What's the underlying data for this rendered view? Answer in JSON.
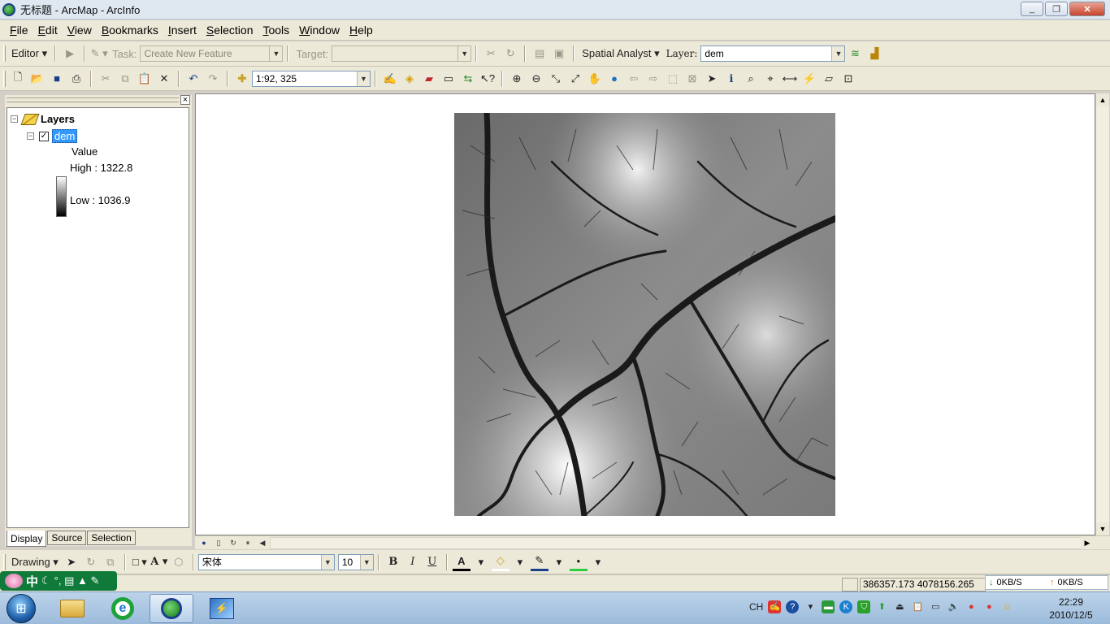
{
  "window": {
    "title": "无标题 - ArcMap - ArcInfo",
    "buttons": [
      "_",
      "❐",
      "✕"
    ]
  },
  "menu": [
    "File",
    "Edit",
    "View",
    "Bookmarks",
    "Insert",
    "Selection",
    "Tools",
    "Window",
    "Help"
  ],
  "editor_toolbar": {
    "editor_label": "Editor",
    "task_label": "Task:",
    "task_value": "Create New Feature",
    "target_label": "Target:",
    "target_value": "",
    "spatial_analyst_label": "Spatial Analyst",
    "layer_label": "Layer:",
    "layer_value": "dem"
  },
  "standard_toolbar": {
    "scale_value": "1:92, 325"
  },
  "toc": {
    "root_label": "Layers",
    "layer_name": "dem",
    "legend_title": "Value",
    "high_label": "High : 1322.8",
    "low_label": "Low : 1036.9",
    "tabs": [
      "Display",
      "Source",
      "Selection"
    ],
    "close": "×"
  },
  "drawing_toolbar": {
    "drawing_label": "Drawing",
    "font_value": "宋体",
    "size_value": "10",
    "bold": "B",
    "italic": "I",
    "underline": "U"
  },
  "ime": {
    "label": "中",
    "extras": "°, ▤ ▲ ✎"
  },
  "status": {
    "coordinates": "386357.173  4078156.265"
  },
  "network": {
    "down": "0KB/S",
    "up": "0KB/S"
  },
  "tray": {
    "lang": "CH"
  },
  "clock": {
    "time": "22:29",
    "date": "2010/12/5"
  },
  "colors": {
    "selection": "#3399ff",
    "toolbar_bg": "#ece9d8",
    "taskbar": "#9cbbdb"
  }
}
